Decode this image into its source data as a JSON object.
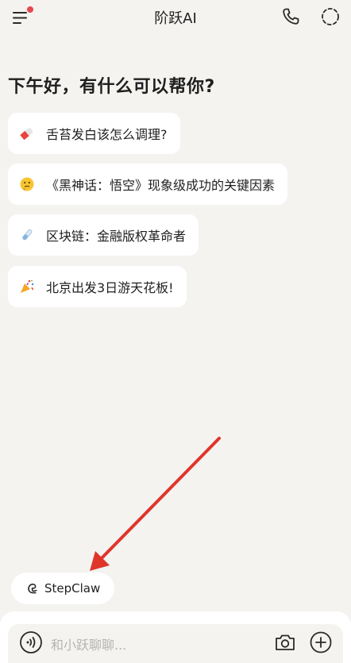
{
  "header": {
    "title": "阶跃AI",
    "accent_dot_color": "#e5484d"
  },
  "greeting": "下午好，有什么可以帮你?",
  "suggestions": [
    {
      "icon": "pill-icon",
      "label": "舌苔发白该怎么调理?"
    },
    {
      "icon": "thinking-face-icon",
      "label": "《黑神话：悟空》现象级成功的关键因素"
    },
    {
      "icon": "test-tube-icon",
      "label": "区块链：金融版权革命者"
    },
    {
      "icon": "confetti-icon",
      "label": "北京出发3日游天花板!"
    }
  ],
  "stepclaw": {
    "label": "StepClaw"
  },
  "input": {
    "placeholder": "和小跃聊聊..."
  },
  "colors": {
    "background": "#f4f3f0",
    "annotation_arrow": "#e0352b"
  }
}
